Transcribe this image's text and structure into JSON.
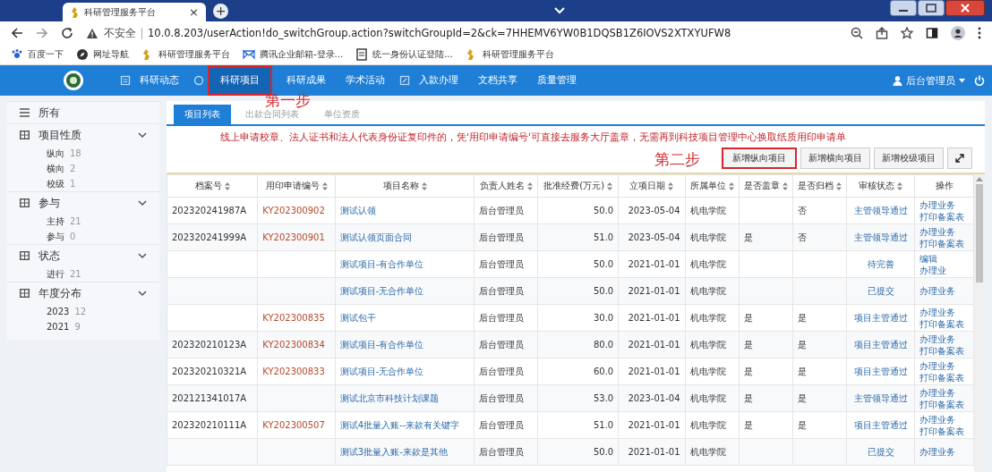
{
  "browser": {
    "tab_title": "科研管理服务平台",
    "tab_close": "×",
    "new_tab": "+",
    "security": "不安全",
    "url": "10.0.8.203/userAction!do_switchGroup.action?switchGroupId=2&ck=7HHEMV6YW0B1DQSB1Z6IOVS2XTXYUFW8",
    "bookmarks": [
      {
        "label": "百度一下"
      },
      {
        "label": "网址导航"
      },
      {
        "label": "科研管理服务平台"
      },
      {
        "label": "腾讯企业邮箱-登录..."
      },
      {
        "label": "统一身份认证登陆..."
      },
      {
        "label": "科研管理服务平台"
      }
    ]
  },
  "nav": {
    "items": [
      {
        "label": "科研动态",
        "selected": false,
        "highlighted": false
      },
      {
        "label": "科研项目",
        "selected": true,
        "highlighted": true
      },
      {
        "label": "科研成果",
        "selected": false,
        "highlighted": false
      },
      {
        "label": "学术活动",
        "selected": false,
        "highlighted": false
      },
      {
        "label": "入款办理",
        "selected": false,
        "highlighted": false
      },
      {
        "label": "文档共享",
        "selected": false,
        "highlighted": false
      },
      {
        "label": "质量管理",
        "selected": false,
        "highlighted": false
      }
    ],
    "user": "后台管理员"
  },
  "annotations": {
    "step_1": "第一步",
    "step_2": "第二步"
  },
  "sidebar": {
    "all": "所有",
    "groups": [
      {
        "label": "项目性质",
        "expanded": true,
        "items": [
          {
            "label": "纵向",
            "count": "18"
          },
          {
            "label": "横向",
            "count": "2"
          },
          {
            "label": "校级",
            "count": "1"
          }
        ]
      },
      {
        "label": "参与",
        "expanded": true,
        "items": [
          {
            "label": "主持",
            "count": "21"
          },
          {
            "label": "参与",
            "count": "0"
          }
        ]
      },
      {
        "label": "状态",
        "expanded": true,
        "items": [
          {
            "label": "进行",
            "count": "21"
          }
        ]
      },
      {
        "label": "年度分布",
        "expanded": true,
        "items": [
          {
            "label": "2023",
            "count": "12"
          },
          {
            "label": "2021",
            "count": "9"
          }
        ]
      }
    ]
  },
  "subtabs": [
    {
      "label": "项目列表",
      "selected": true
    },
    {
      "label": "出款合同列表",
      "selected": false
    },
    {
      "label": "单位资质",
      "selected": false
    }
  ],
  "notice": "线上申请校章、法人证书和法人代表身份证复印件的，凭'用印申请编号'可直接去服务大厅盖章，无需再到科技项目管理中心换取纸质用印申请单",
  "buttons": [
    {
      "label": "新增纵向项目",
      "highlighted": true
    },
    {
      "label": "新增横向项目",
      "highlighted": false
    },
    {
      "label": "新增校级项目",
      "highlighted": false
    }
  ],
  "table": {
    "columns": [
      {
        "label": "档案号",
        "kind": "text",
        "sortable": true
      },
      {
        "label": "用印申请编号",
        "kind": "code",
        "sortable": true
      },
      {
        "label": "项目名称",
        "kind": "link",
        "sortable": true
      },
      {
        "label": "负责人姓名",
        "kind": "text",
        "sortable": true
      },
      {
        "label": "批准经费(万元)",
        "kind": "number",
        "sortable": true
      },
      {
        "label": "立项日期",
        "kind": "number",
        "sortable": true
      },
      {
        "label": "所属单位",
        "kind": "text",
        "sortable": true
      },
      {
        "label": "是否盖章",
        "kind": "text",
        "sortable": true
      },
      {
        "label": "是否归档",
        "kind": "text",
        "sortable": true
      },
      {
        "label": "审核状态",
        "kind": "status",
        "sortable": true
      },
      {
        "label": "操作",
        "kind": "actions",
        "sortable": false
      }
    ],
    "rows": [
      {
        "cells": [
          "202320241987A",
          "KY202300902",
          "测试认领",
          "后台管理员",
          "50.0",
          "2023-05-04",
          "机电学院",
          "",
          "否",
          "主管领导通过",
          [
            "办理业务",
            "打印备案表"
          ]
        ]
      },
      {
        "cells": [
          "202320241999A",
          "KY202300901",
          "测试认领页面合同",
          "后台管理员",
          "51.0",
          "2023-05-04",
          "机电学院",
          "是",
          "否",
          "主管领导通过",
          [
            "办理业务",
            "打印备案表"
          ]
        ]
      },
      {
        "cells": [
          "",
          "",
          "测试项目-有合作单位",
          "后台管理员",
          "50.0",
          "2021-01-01",
          "机电学院",
          "",
          "",
          "待完善",
          [
            "编辑",
            "办理业"
          ]
        ]
      },
      {
        "cells": [
          "",
          "",
          "测试项目-无合作单位",
          "后台管理员",
          "50.0",
          "2021-01-01",
          "机电学院",
          "",
          "",
          "已提交",
          [
            "办理业务"
          ]
        ]
      },
      {
        "cells": [
          "",
          "KY202300835",
          "测试包干",
          "后台管理员",
          "30.0",
          "2021-01-01",
          "机电学院",
          "是",
          "是",
          "项目主管通过",
          [
            "办理业务",
            "打印备案表"
          ]
        ]
      },
      {
        "cells": [
          "202320210123A",
          "KY202300834",
          "测试项目-有合作单位",
          "后台管理员",
          "80.0",
          "2021-01-01",
          "机电学院",
          "是",
          "是",
          "项目主管通过",
          [
            "办理业务",
            "打印备案表"
          ]
        ]
      },
      {
        "cells": [
          "202320210321A",
          "KY202300833",
          "测试项目-无合作单位",
          "后台管理员",
          "60.0",
          "2021-01-01",
          "机电学院",
          "是",
          "是",
          "项目主管通过",
          [
            "办理业务",
            "打印备案表"
          ]
        ]
      },
      {
        "cells": [
          "202121341017A",
          "",
          "测试北京市科技计划课题",
          "后台管理员",
          "53.0",
          "2023-01-04",
          "机电学院",
          "是",
          "是",
          "主管领导通过",
          [
            "办理业务",
            "打印备案表"
          ]
        ]
      },
      {
        "cells": [
          "202320210111A",
          "KY202300507",
          "测试4批量入账--来款有关键字",
          "后台管理员",
          "51.0",
          "2021-01-01",
          "机电学院",
          "是",
          "是",
          "项目主管通过",
          [
            "办理业务",
            "打印备案表"
          ]
        ]
      },
      {
        "cells": [
          "",
          "",
          "测试3批量入账-来款是其他",
          "后台管理员",
          "50.0",
          "2021-01-01",
          "机电学院",
          "",
          "",
          "已提交",
          [
            "办理业务"
          ]
        ]
      }
    ]
  }
}
